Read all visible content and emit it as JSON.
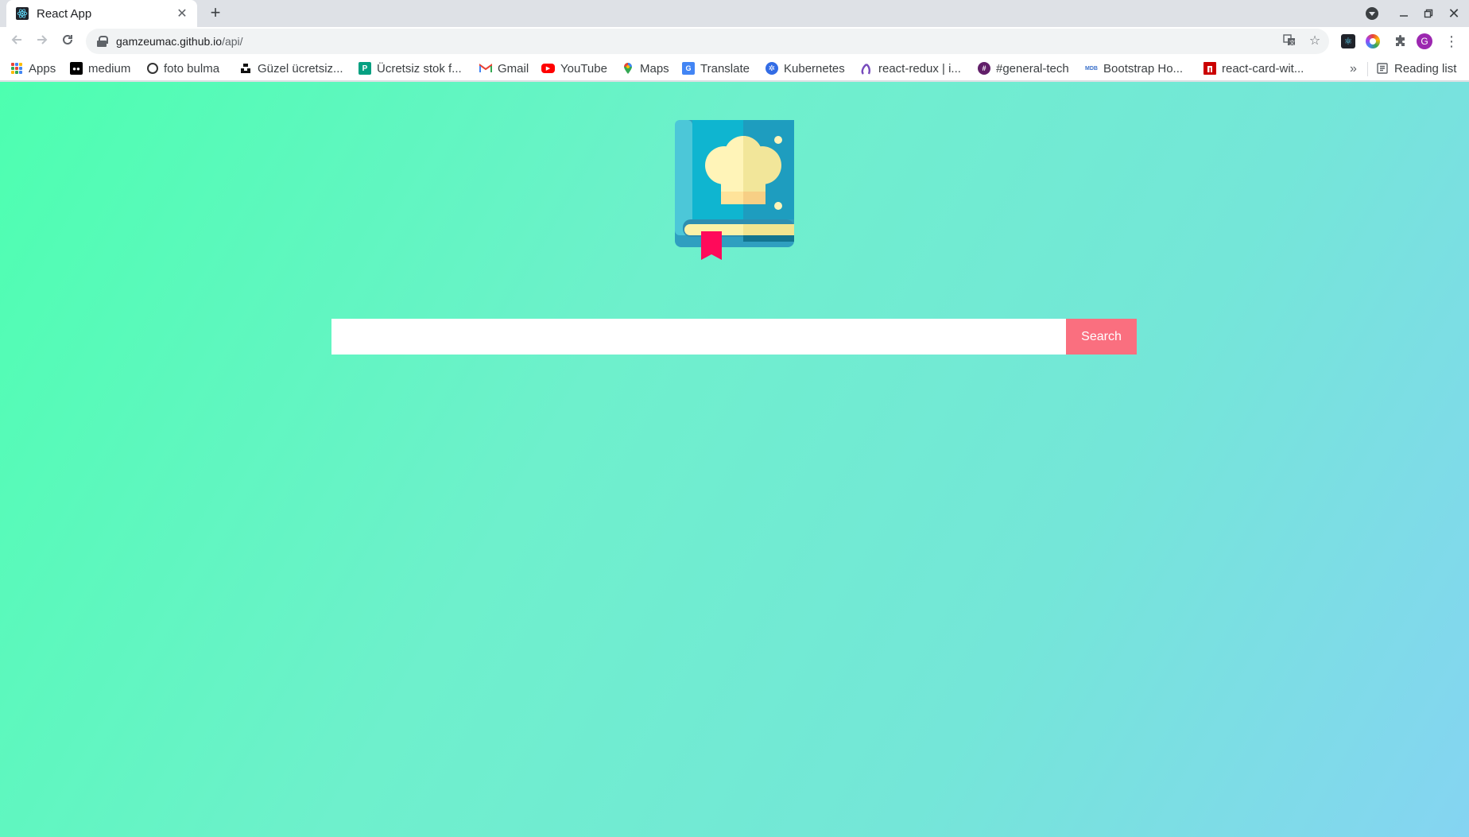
{
  "browser": {
    "tab": {
      "title": "React App",
      "favicon": "react-icon"
    },
    "new_tab_label": "+",
    "url": {
      "host": "gamzeumac.github.io",
      "path": "/api/"
    },
    "profile_initial": "G"
  },
  "bookmarks": [
    {
      "label": "Apps",
      "icon": "apps-grid-icon"
    },
    {
      "label": "medium",
      "icon": "medium-icon"
    },
    {
      "label": "foto bulma",
      "icon": "foto-bulma-icon"
    },
    {
      "label": "Güzel ücretsiz...",
      "icon": "unsplash-icon"
    },
    {
      "label": "Ücretsiz stok f...",
      "icon": "pexels-icon"
    },
    {
      "label": "Gmail",
      "icon": "gmail-icon"
    },
    {
      "label": "YouTube",
      "icon": "youtube-icon"
    },
    {
      "label": "Maps",
      "icon": "maps-icon"
    },
    {
      "label": "Translate",
      "icon": "translate-icon"
    },
    {
      "label": "Kubernetes",
      "icon": "kubernetes-icon"
    },
    {
      "label": "react-redux | i...",
      "icon": "redux-icon"
    },
    {
      "label": "#general-tech",
      "icon": "slack-icon"
    },
    {
      "label": "Bootstrap Ho...",
      "icon": "mdb-icon"
    },
    {
      "label": "react-card-wit...",
      "icon": "npm-icon"
    }
  ],
  "bookmarks_overflow": "»",
  "reading_list": "Reading list",
  "page": {
    "search": {
      "value": "",
      "placeholder": ""
    },
    "search_button": "Search"
  },
  "colors": {
    "gradient_start": "#4dffb0",
    "gradient_end": "#85d4f2",
    "search_button": "#fa6f7f"
  }
}
